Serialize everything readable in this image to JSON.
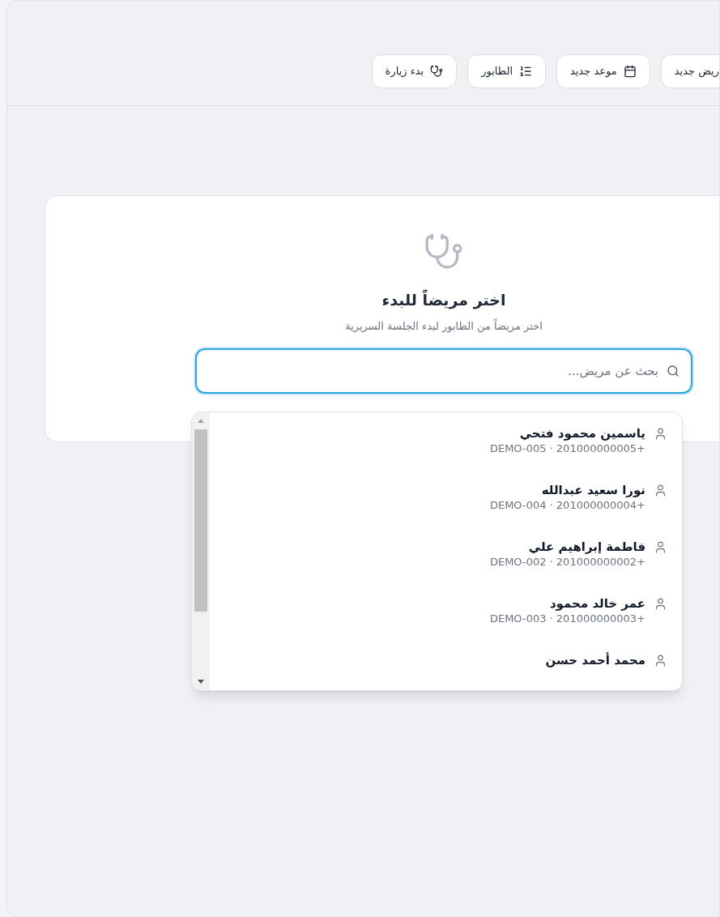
{
  "toolbar": [
    {
      "label": "ريض جديد",
      "cut": true
    },
    {
      "label": "موعد جديد",
      "cut": false
    },
    {
      "label": "الطابور",
      "cut": false
    },
    {
      "label": "بدء زيارة",
      "cut": false
    }
  ],
  "empty_state": {
    "title": "اختر مريضاً للبدء",
    "subtitle": "اختر مريضاً من الطابور لبدء الجلسة السريرية"
  },
  "search": {
    "placeholder": "بحث عن مريض...",
    "focused": true
  },
  "results": [
    {
      "name": "ياسمين محمود فتحي",
      "details": "DEMO-005 · 201000000005+"
    },
    {
      "name": "نورا سعيد عبدالله",
      "details": "DEMO-004 · 201000000004+"
    },
    {
      "name": "فاطمة إبراهيم علي",
      "details": "DEMO-002 · 201000000002+"
    },
    {
      "name": "عمر خالد محمود",
      "details": "DEMO-003 · 201000000003+"
    },
    {
      "name": "محمد أحمد حسن"
    }
  ]
}
